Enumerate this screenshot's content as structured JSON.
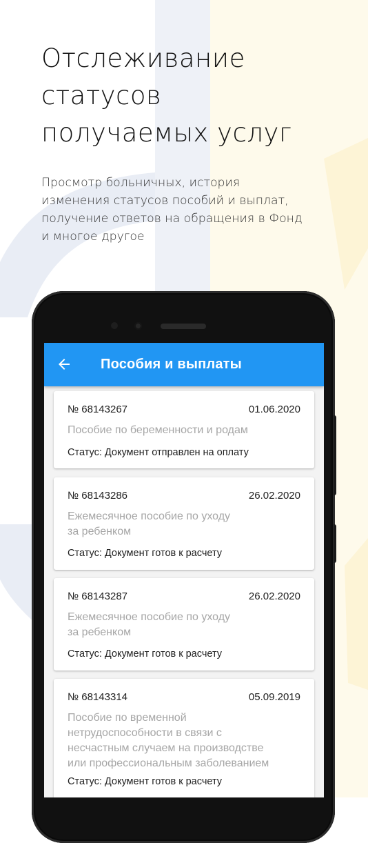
{
  "headline": {
    "line1": "Отслеживание",
    "line2": "статусов",
    "line3": "получаемых услуг"
  },
  "subtitle": {
    "line1": "Просмотр больничных, история",
    "line2": "изменения статусов пособий и выплат,",
    "line3": "получение ответов на обращения в Фонд",
    "line4": "и многое другое"
  },
  "colors": {
    "accent": "#2196f3",
    "bg_blue": "#e9edf5",
    "bg_yellow": "#fdf7e0"
  },
  "app": {
    "title": "Пособия и выплаты",
    "back_icon": "arrow-left-icon"
  },
  "cards": [
    {
      "number": "№ 68143267",
      "date": "01.06.2020",
      "title_lines": [
        "Пособие по беременности и родам"
      ],
      "status": "Статус: Документ отправлен на оплату"
    },
    {
      "number": "№ 68143286",
      "date": "26.02.2020",
      "title_lines": [
        "Ежемесячное пособие по уходу",
        "за ребенком"
      ],
      "status": "Статус: Документ готов к расчету"
    },
    {
      "number": "№ 68143287",
      "date": "26.02.2020",
      "title_lines": [
        "Ежемесячное пособие по уходу",
        "за ребенком"
      ],
      "status": "Статус: Документ готов к расчету"
    },
    {
      "number": "№ 68143314",
      "date": "05.09.2019",
      "title_lines": [
        "Пособие по временной",
        "нетрудоспособности в связи с",
        "несчастным случаем на производстве",
        "или профессиональным заболеванием"
      ],
      "status": "Статус: Документ готов к расчету"
    }
  ]
}
